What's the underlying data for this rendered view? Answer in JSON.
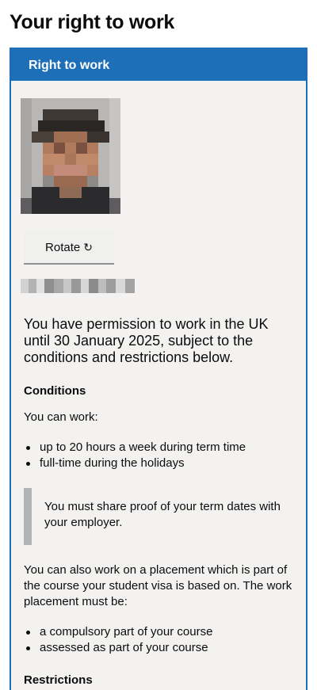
{
  "page": {
    "title": "Your right to work"
  },
  "card": {
    "header": "Right to work",
    "rotate_button": {
      "label": "Rotate",
      "icon": "↻"
    },
    "lead": "You have permission to work in the UK until 30 January 2025, subject to the conditions and restrictions below.",
    "conditions": {
      "heading": "Conditions",
      "intro": "You can work:",
      "items": [
        "up to 20 hours a week during term time",
        "full-time during the holidays"
      ],
      "inset": "You must share proof of your term dates with your employer.",
      "placement_text": "You can also work on a placement which is part of the course your student visa is based on. The work placement must be:",
      "placement_items": [
        "a compulsory part of your course",
        "assessed as part of your course"
      ]
    },
    "restrictions": {
      "heading": "Restrictions"
    }
  },
  "colors": {
    "header_blue": "#1d70b8",
    "card_background": "#f3f2f1",
    "inset_border": "#b1b4b6",
    "text": "#0b0c0c"
  }
}
